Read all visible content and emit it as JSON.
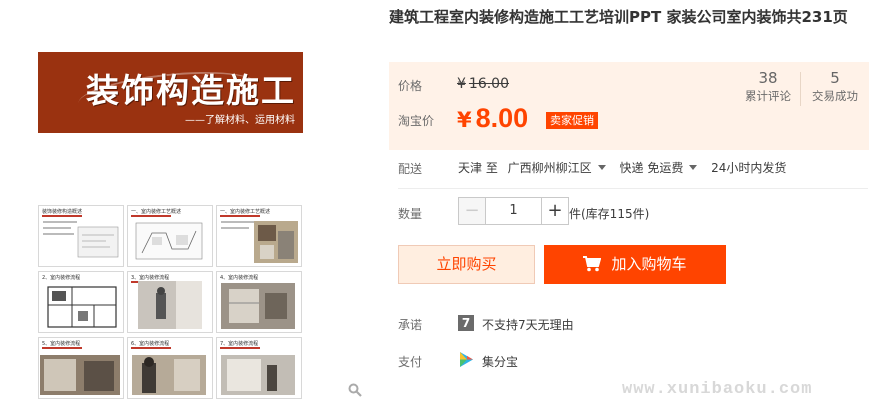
{
  "product": {
    "title": "建筑工程室内装修构造施工工艺培训PPT 家装公司室内装饰共231页",
    "banner_title": "装饰构造施工",
    "banner_subtitle": "——了解材料、运用材料"
  },
  "gallery": {
    "thumbs": [
      {
        "caption": "装饰装修构造概述"
      },
      {
        "caption": "一、室内装修工艺概述"
      },
      {
        "caption": "一、室内装修工艺概述"
      },
      {
        "caption": "2、室内装修流程"
      },
      {
        "caption": "3、室内装修流程"
      },
      {
        "caption": "4、室内装修流程"
      },
      {
        "caption": "5、室内装修流程"
      },
      {
        "caption": "6、室内装修流程"
      },
      {
        "caption": "7、室内装修流程"
      }
    ],
    "zoom_icon": "search-icon"
  },
  "price": {
    "orig_label": "价格",
    "currency": "¥",
    "original": "16.00",
    "sale_label": "淘宝价",
    "sale": "8.00",
    "promo": "卖家促销",
    "reviews_count": "38",
    "reviews_label": "累计评论",
    "sold_count": "5",
    "sold_label": "交易成功"
  },
  "shipping": {
    "label": "配送",
    "from": "天津 至",
    "to": "广西柳州柳江区",
    "method": "快递 免运费",
    "dispatch": "24小时内发货"
  },
  "quantity": {
    "label": "数量",
    "minus": "−",
    "value": "1",
    "plus": "+",
    "stock": "件(库存115件)"
  },
  "actions": {
    "buy_now": "立即购买",
    "add_to_cart": "加入购物车"
  },
  "service": {
    "promise_label": "承诺",
    "promise_icon_text": "7",
    "promise_text": "不支持7天无理由",
    "pay_label": "支付",
    "pay_text": "集分宝"
  },
  "watermark": "www.xunibaoku.com",
  "colors": {
    "accent": "#ff4400",
    "price_bg": "#fff2e8",
    "banner": "#9a3210"
  }
}
